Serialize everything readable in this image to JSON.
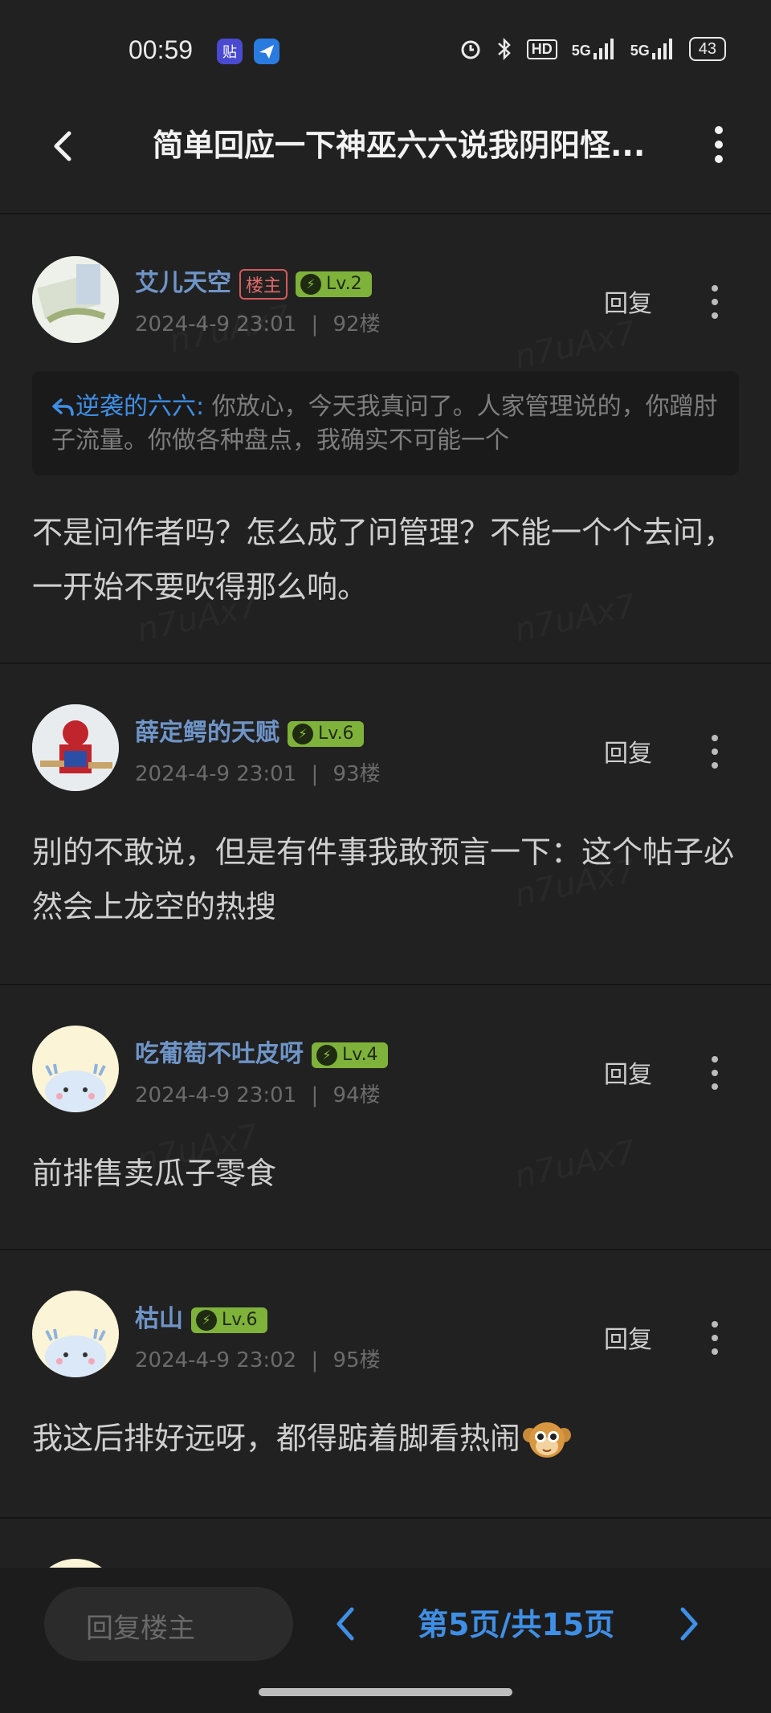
{
  "status_bar": {
    "time": "00:59",
    "app_icons": [
      "tieba-icon",
      "feishu-bird-icon"
    ],
    "network_5g": "5G",
    "network_5g_2": "5G",
    "hd_label": "HD",
    "battery": "43"
  },
  "header": {
    "title": "简单回应一下神巫六六说我阴阳怪..."
  },
  "posts": [
    {
      "username": "艾儿天空",
      "owner_badge": "楼主",
      "level": "Lv.2",
      "date": "2024-4-9 23:01",
      "separator": "|",
      "floor": "92楼",
      "reply_label": "回复",
      "quote_author": "逆袭的六六:",
      "quote_text": "你放心，今天我真问了。人家管理说的，你蹭肘子流量。你做各种盘点，我确实不可能一个",
      "content": "不是问作者吗？怎么成了问管理？不能一个个去问，一开始不要吹得那么响。"
    },
    {
      "username": "薛定鳄的天赋",
      "level": "Lv.6",
      "date": "2024-4-9 23:01",
      "separator": "|",
      "floor": "93楼",
      "reply_label": "回复",
      "content": "别的不敢说，但是有件事我敢预言一下：这个帖子必然会上龙空的热搜"
    },
    {
      "username": "吃葡萄不吐皮呀",
      "level": "Lv.4",
      "date": "2024-4-9 23:01",
      "separator": "|",
      "floor": "94楼",
      "reply_label": "回复",
      "content": "前排售卖瓜子零食"
    },
    {
      "username": "枯山",
      "level": "Lv.6",
      "date": "2024-4-9 23:02",
      "separator": "|",
      "floor": "95楼",
      "reply_label": "回复",
      "content": "我这后排好远呀，都得踮着脚看热闹"
    }
  ],
  "watermark": "n7uAx7",
  "bottom_bar": {
    "reply_placeholder": "回复楼主",
    "pager": "第5页/共15页"
  },
  "colors": {
    "background": "#212121",
    "accent_blue": "#3f8fe6",
    "username_blue": "#6f95c8",
    "level_green": "#7fb23a",
    "owner_red": "#e06b6b"
  }
}
